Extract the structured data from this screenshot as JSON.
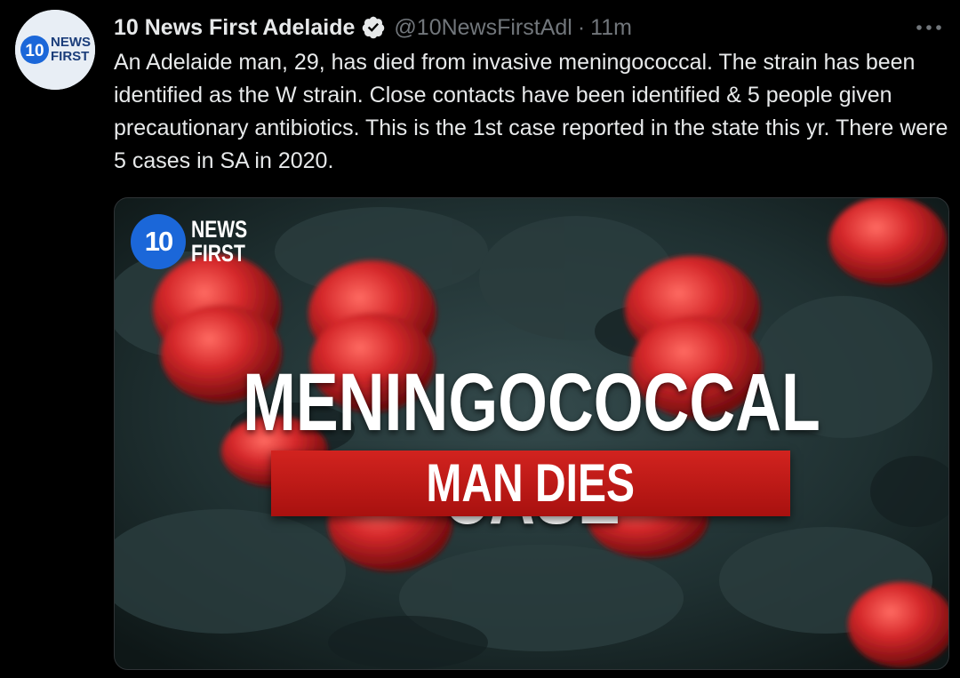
{
  "account": {
    "display_name": "10 News First Adelaide",
    "handle": "@10NewsFirstAdl",
    "separator": "·",
    "time": "11m",
    "avatar_logo_number": "10",
    "avatar_logo_line1": "NEWS",
    "avatar_logo_line2": "FIRST"
  },
  "tweet": {
    "text": "An Adelaide man, 29, has died from invasive meningococcal. The strain has been identified as the W strain. Close contacts have been identified & 5 people given precautionary antibiotics. This is the 1st case reported in the state this yr. There were 5 cases in SA in 2020."
  },
  "media": {
    "logo_number": "10",
    "logo_line1": "NEWS",
    "logo_line2": "FIRST",
    "headline": "MENINGOCOCCAL CASE",
    "banner": "MAN DIES"
  },
  "icons": {
    "verified": "verified-badge-icon",
    "more": "more-options-icon"
  },
  "colors": {
    "background": "#000000",
    "text": "#e7e9ea",
    "secondary_text": "#71767b",
    "logo_blue": "#1b67d9",
    "banner_red": "#c41a17",
    "bacteria_red": "#d6292b"
  }
}
